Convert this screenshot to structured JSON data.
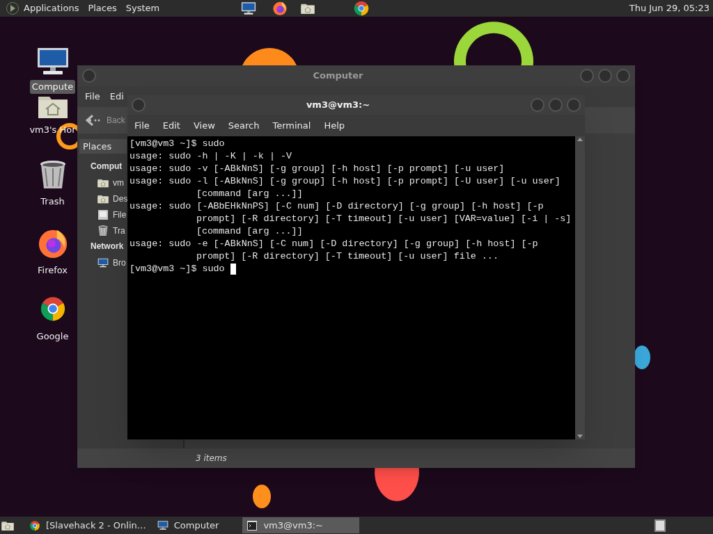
{
  "top_panel": {
    "menus": [
      "Applications",
      "Places",
      "System"
    ],
    "clock": "Thu Jun 29, 05:23"
  },
  "desktop_icons": [
    {
      "label": "Compute",
      "kind": "computer",
      "selected": true
    },
    {
      "label": "vm3's Hor",
      "kind": "home",
      "selected": false
    },
    {
      "label": "Trash",
      "kind": "trash",
      "selected": false
    },
    {
      "label": "Firefox",
      "kind": "firefox",
      "selected": false
    },
    {
      "label": "Google",
      "kind": "chrome",
      "selected": false
    }
  ],
  "file_manager": {
    "title": "Computer",
    "menus": [
      "File",
      "Edi"
    ],
    "back_label": "Back",
    "sidebar": {
      "header": "Places",
      "sections": [
        {
          "label": "Comput",
          "items": [
            {
              "label": "vm",
              "kind": "home"
            },
            {
              "label": "Des",
              "kind": "desktop"
            },
            {
              "label": "File",
              "kind": "drive"
            },
            {
              "label": "Tra",
              "kind": "trash"
            }
          ]
        },
        {
          "label": "Network",
          "items": [
            {
              "label": "Bro",
              "kind": "network"
            }
          ]
        }
      ]
    },
    "status": "3 items"
  },
  "terminal": {
    "title": "vm3@vm3:~",
    "menus": [
      "File",
      "Edit",
      "View",
      "Search",
      "Terminal",
      "Help"
    ],
    "lines": [
      {
        "kind": "line",
        "text": "[vm3@vm3 ~]$ sudo"
      },
      {
        "kind": "line",
        "text": "usage: sudo -h | -K | -k | -V"
      },
      {
        "kind": "line",
        "text": "usage: sudo -v [-ABkNnS] [-g group] [-h host] [-p prompt] [-u user]"
      },
      {
        "kind": "line",
        "text": "usage: sudo -l [-ABkNnS] [-g group] [-h host] [-p prompt] [-U user] [-u user]"
      },
      {
        "kind": "continuation",
        "text": "[command [arg ...]]"
      },
      {
        "kind": "line",
        "text": "usage: sudo [-ABbEHkNnPS] [-C num] [-D directory] [-g group] [-h host] [-p"
      },
      {
        "kind": "continuation",
        "text": "prompt] [-R directory] [-T timeout] [-u user] [VAR=value] [-i | -s]"
      },
      {
        "kind": "continuation",
        "text": "[command [arg ...]]"
      },
      {
        "kind": "line",
        "text": "usage: sudo -e [-ABkNnS] [-C num] [-D directory] [-g group] [-h host] [-p"
      },
      {
        "kind": "continuation",
        "text": "prompt] [-R directory] [-T timeout] [-u user] file ..."
      },
      {
        "kind": "line",
        "text": "[vm3@vm3 ~]$ sudo"
      }
    ],
    "cursor": true
  },
  "taskbar": {
    "items": [
      {
        "label": "[Slavehack 2 - Onlin…",
        "kind": "browser",
        "selected": false
      },
      {
        "label": "Computer",
        "kind": "computer",
        "selected": false
      },
      {
        "label": "vm3@vm3:~",
        "kind": "terminal",
        "selected": true
      }
    ]
  }
}
